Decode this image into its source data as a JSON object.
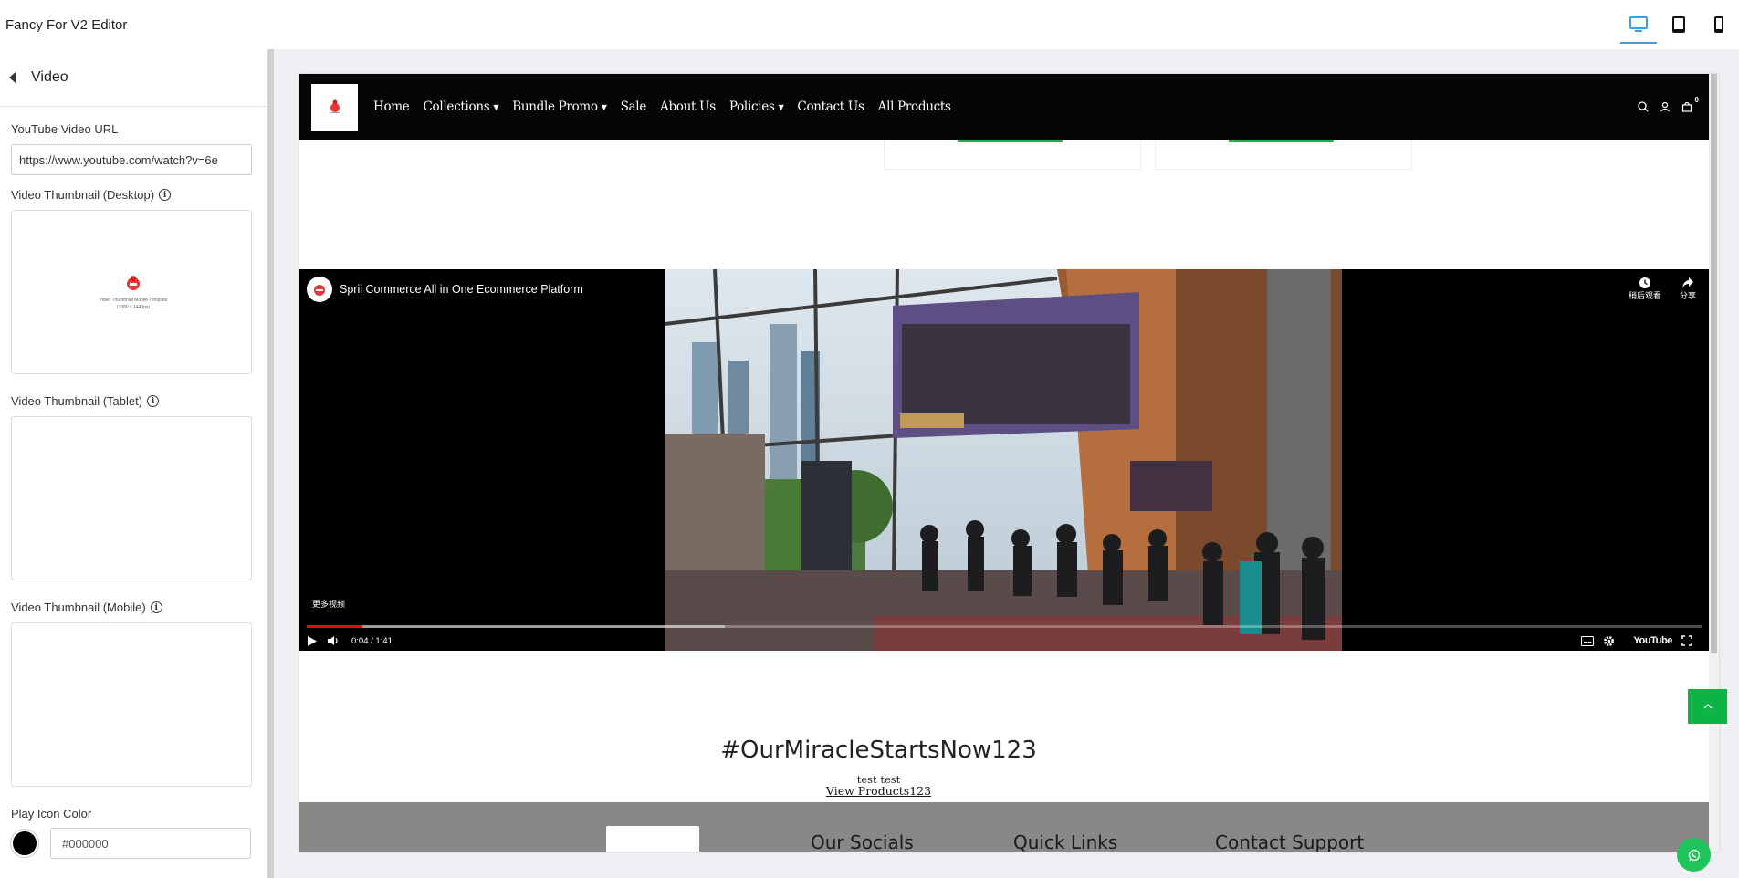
{
  "app": {
    "title": "Fancy For V2 Editor"
  },
  "device_switch": {
    "active": "desktop",
    "items": [
      "desktop-icon",
      "tablet-icon",
      "mobile-icon"
    ]
  },
  "sidebar": {
    "panel_title": "Video",
    "youtube_url_label": "YouTube Video URL",
    "youtube_url_value": "https://www.youtube.com/watch?v=6e",
    "thumb_desktop_label": "Video Thumbnail (Desktop)",
    "thumb_desktop_caption": "Video Thumbnail Mobile Template",
    "thumb_desktop_size": "(1080 x 1440px)",
    "thumb_tablet_label": "Video Thumbnail (Tablet)",
    "thumb_mobile_label": "Video Thumbnail (Mobile)",
    "play_icon_color_label": "Play Icon Color",
    "play_icon_color_value": "#000000",
    "info_glyph": "i"
  },
  "site": {
    "nav": [
      {
        "label": "Home",
        "dropdown": false
      },
      {
        "label": "Collections",
        "dropdown": true
      },
      {
        "label": "Bundle Promo",
        "dropdown": true
      },
      {
        "label": "Sale",
        "dropdown": false
      },
      {
        "label": "About Us",
        "dropdown": false
      },
      {
        "label": "Policies",
        "dropdown": true
      },
      {
        "label": "Contact Us",
        "dropdown": false
      },
      {
        "label": "All Products",
        "dropdown": false
      }
    ],
    "cart_count": "0",
    "video": {
      "title": "Sprii Commerce All in One Ecommerce Platform",
      "watch_later": "稍后观看",
      "share": "分享",
      "more_videos": "更多视频",
      "time": "0:04 / 1:41",
      "progress_played": 0.04,
      "youtube_label": "YouTube"
    },
    "promo": {
      "title": "#OurMiracleStartsNow123",
      "subtitle": "test test",
      "link": "View Products123"
    },
    "footer": {
      "headings": [
        "Our Socials",
        "Quick Links",
        "Contact Support"
      ]
    }
  },
  "colors": {
    "accent_green": "#0cb345",
    "whatsapp_green": "#1fc45a",
    "device_active": "#3aa0e8",
    "nav_bg": "#050505",
    "footer_bg": "#8a8787"
  }
}
